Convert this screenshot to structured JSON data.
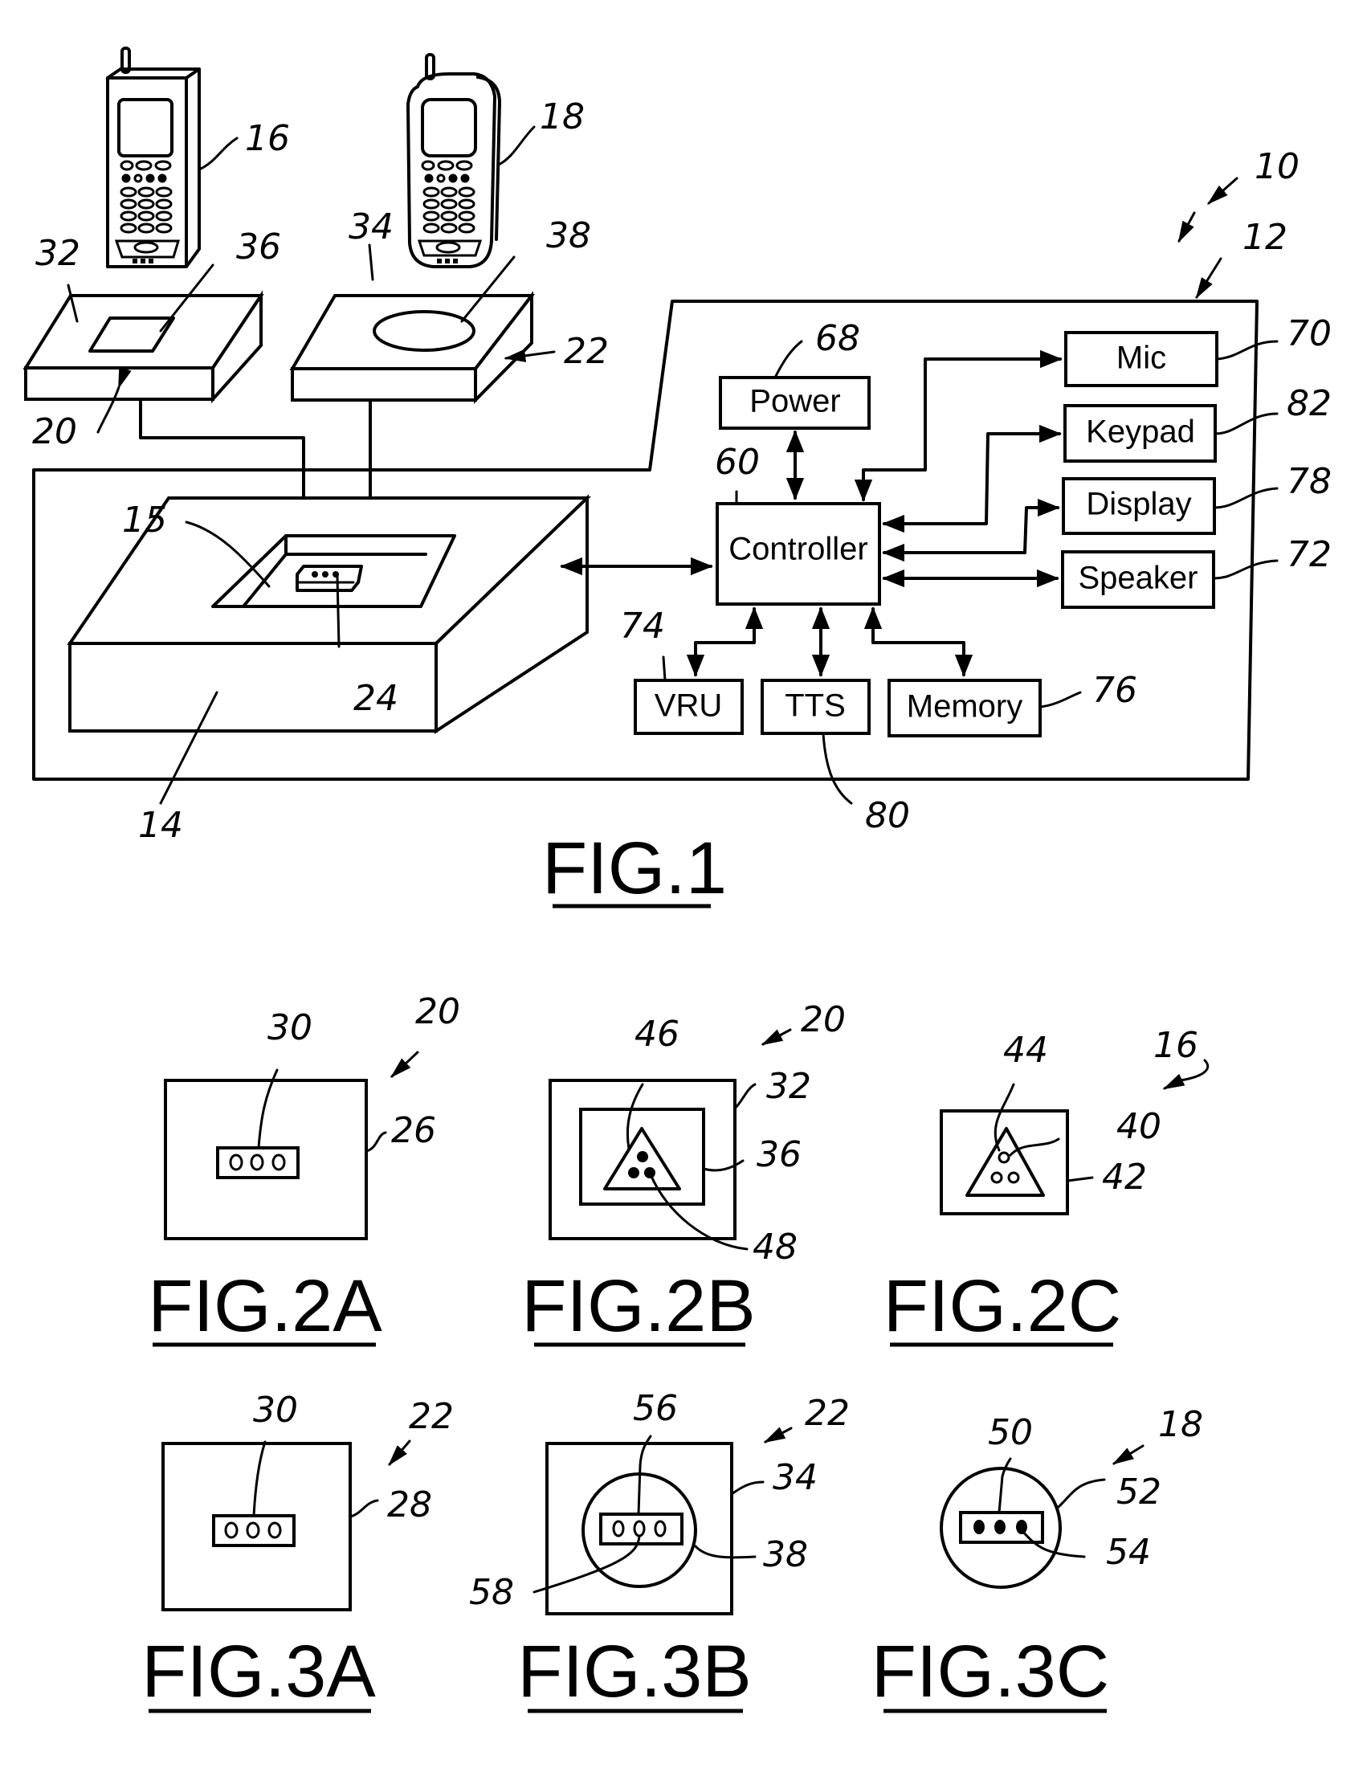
{
  "figure1": {
    "caption": "FIG.1",
    "blocks": {
      "controller": "Controller",
      "power": "Power",
      "mic": "Mic",
      "keypad": "Keypad",
      "display": "Display",
      "speaker": "Speaker",
      "vru": "VRU",
      "tts": "TTS",
      "memory": "Memory"
    },
    "refs": {
      "system": "10",
      "housing": "12",
      "base": "14",
      "recess": "15",
      "phone_a": "16",
      "phone_b": "18",
      "adapter_a": "20",
      "adapter_b": "22",
      "connector": "24",
      "adapter_a_top": "32",
      "adapter_b_top": "34",
      "adapter_a_pad": "36",
      "adapter_b_pad": "38",
      "controller": "60",
      "power": "68",
      "mic": "70",
      "speaker": "72",
      "vru": "74",
      "memory": "76",
      "display": "78",
      "tts": "80",
      "keypad": "82"
    }
  },
  "figure2a": {
    "caption": "FIG.2A",
    "refs": {
      "assembly": "20",
      "connector": "30",
      "body": "26"
    }
  },
  "figure2b": {
    "caption": "FIG.2B",
    "refs": {
      "assembly": "20",
      "key": "46",
      "top": "32",
      "pad": "36",
      "contacts": "48"
    }
  },
  "figure2c": {
    "caption": "FIG.2C",
    "refs": {
      "assembly": "16",
      "key": "44",
      "contacts": "40",
      "body": "42"
    }
  },
  "figure3a": {
    "caption": "FIG.3A",
    "refs": {
      "assembly": "22",
      "connector": "30",
      "body": "28"
    }
  },
  "figure3b": {
    "caption": "FIG.3B",
    "refs": {
      "assembly": "22",
      "connector": "56",
      "top": "34",
      "pad": "38",
      "contact": "58"
    }
  },
  "figure3c": {
    "caption": "FIG.3C",
    "refs": {
      "assembly": "18",
      "connector": "50",
      "body": "52",
      "contact": "54"
    }
  }
}
